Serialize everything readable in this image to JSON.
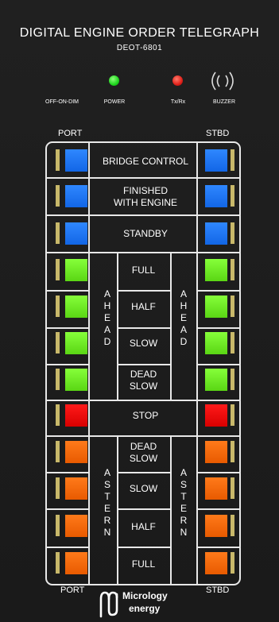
{
  "header": {
    "title": "DIGITAL ENGINE ORDER TELEGRAPH",
    "model": "DEOT-6801"
  },
  "indicators": {
    "off_on_dim": "OFF-ON-DIM",
    "power": "POWER",
    "txrx": "Tx/Rx",
    "buzzer": "BUZZER"
  },
  "sides": {
    "port_top": "PORT",
    "stbd_top": "STBD",
    "port_bottom": "PORT",
    "stbd_bottom": "STBD"
  },
  "commands": {
    "bridge_control": "BRIDGE CONTROL",
    "finished_with_engine_1": "FINISHED",
    "finished_with_engine_2": "WITH ENGINE",
    "standby": "STANDBY",
    "ahead_full": "FULL",
    "ahead_half": "HALF",
    "ahead_slow": "SLOW",
    "ahead_dead_slow_1": "DEAD",
    "ahead_dead_slow_2": "SLOW",
    "stop": "STOP",
    "astern_dead_slow_1": "DEAD",
    "astern_dead_slow_2": "SLOW",
    "astern_slow": "SLOW",
    "astern_half": "HALF",
    "astern_full": "FULL"
  },
  "groups": {
    "ahead": [
      "A",
      "H",
      "E",
      "A",
      "D"
    ],
    "astern": [
      "A",
      "S",
      "T",
      "E",
      "R",
      "N"
    ]
  },
  "logo": {
    "line1": "Micrology",
    "line2": "energy"
  },
  "colors": {
    "blue_lamp": "#1f78ff",
    "green_lamp": "#6ee820",
    "red_lamp": "#f00000",
    "orange_lamp": "#ff6a00",
    "power_led": "#1ed61e",
    "txrx_led": "#e0201a"
  }
}
